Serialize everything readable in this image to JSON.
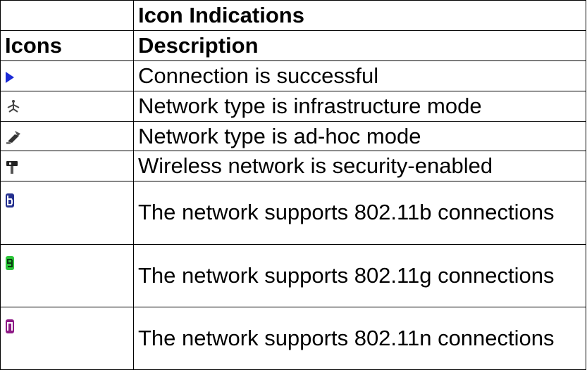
{
  "table": {
    "title": "Icon Indications",
    "headers": {
      "icons": "Icons",
      "description": "Description"
    },
    "rows": [
      {
        "icon": "play-arrow-icon",
        "color": "#1c2bd6",
        "description": "Connection is successful"
      },
      {
        "icon": "infrastructure-network-icon",
        "color": "#444444",
        "description": "Network type is infrastructure mode"
      },
      {
        "icon": "adhoc-network-icon",
        "color": "#333333",
        "description": "Network type is ad-hoc mode"
      },
      {
        "icon": "security-lock-icon",
        "color": "#222222",
        "description": "Wireless network is security-enabled"
      },
      {
        "icon": "badge-b-icon",
        "color": "#24308f",
        "description": "The network supports 802.11b connections"
      },
      {
        "icon": "badge-g-icon",
        "color": "#2cc43a",
        "description": "The network supports 802.11g connections"
      },
      {
        "icon": "badge-n-icon",
        "color": "#8e1a86",
        "description": "The network supports 802.11n connections"
      }
    ]
  }
}
